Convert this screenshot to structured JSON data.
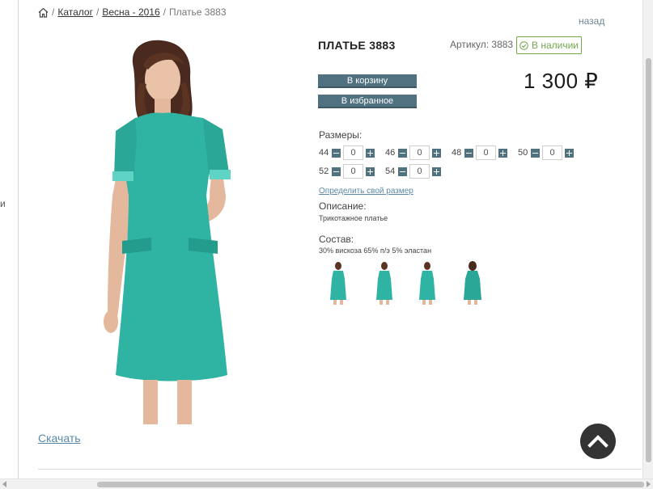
{
  "breadcrumb": {
    "catalog": "Каталог",
    "season": "Весна - 2016",
    "current": "Платье 3883",
    "separator": "/"
  },
  "left_fragment": "и",
  "back_label": "назад",
  "product": {
    "title": "ПЛАТЬЕ 3883",
    "article": "Артикул: 3883",
    "stock": "В наличии",
    "price": "1 300 ₽",
    "dress_color": "#2fb3a3"
  },
  "buttons": {
    "cart": "В корзину",
    "favorite": "В избранное"
  },
  "sizes": {
    "label": "Размеры:",
    "items": [
      {
        "size": "44",
        "qty": "0"
      },
      {
        "size": "46",
        "qty": "0"
      },
      {
        "size": "48",
        "qty": "0"
      },
      {
        "size": "50",
        "qty": "0"
      },
      {
        "size": "52",
        "qty": "0"
      },
      {
        "size": "54",
        "qty": "0"
      }
    ]
  },
  "size_link": "Определить свой размер",
  "description": {
    "label": "Описание:",
    "text": "Трикотажное платье"
  },
  "composition": {
    "label": "Состав:",
    "text": "30% вискоза 65% п/э 5% эластан"
  },
  "download": "Скачать",
  "colors": {
    "button": "#4f7180",
    "stock": "#74a84f",
    "link": "#5a8aa8"
  }
}
